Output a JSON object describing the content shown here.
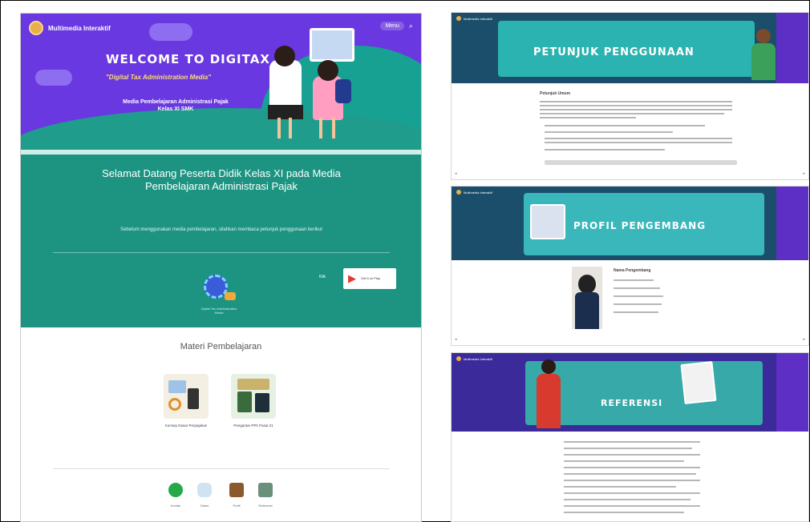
{
  "left": {
    "brand": "Multimedia Interaktif",
    "nav": {
      "pill": "Menu",
      "search": "⌕"
    },
    "hero": {
      "title": "WELCOME TO DIGITAX",
      "subtitle": "\"Digital Tax Administration Media\"",
      "media": "Media Pembelajaran Administrasi Pajak Kelas XI SMK"
    },
    "green": {
      "welcome": "Selamat Datang Peserta Didik Kelas XI pada Media Pembelajaran Administrasi Pajak",
      "desc": "Sebelum menggunakan media pembelajaran, silahkan membaca petunjuk penggunaan berikut",
      "globe_caption": "Digital Tax Administration Media",
      "play_label": "Klik",
      "play_text": "Get it on Play"
    },
    "materi": {
      "title": "Materi Pembelajaran",
      "cards": [
        {
          "label": "Konsep Dasar Perpajakan"
        },
        {
          "label": "Pengantar PPh Pasal 21"
        }
      ]
    },
    "bottom_icons": [
      {
        "label": "Kontak",
        "icon": "whatsapp-icon",
        "color": "#25a84a"
      },
      {
        "label": "Galeri",
        "icon": "cloud-icon",
        "color": "#cfe3f3"
      },
      {
        "label": "Profil",
        "icon": "book-icon",
        "color": "#8a5a2e"
      },
      {
        "label": "Referensi",
        "icon": "magnifier-icon",
        "color": "#6a8f7a"
      }
    ]
  },
  "panels": {
    "petunjuk": {
      "title": "PETUNJUK PENGGUNAAN",
      "section": "Petunjuk Umum"
    },
    "profil": {
      "title": "PROFIL PENGEMBANG",
      "name": "Nama Pengembang"
    },
    "referensi": {
      "title": "REFERENSI"
    },
    "brand": "Multimedia Interaktif"
  }
}
